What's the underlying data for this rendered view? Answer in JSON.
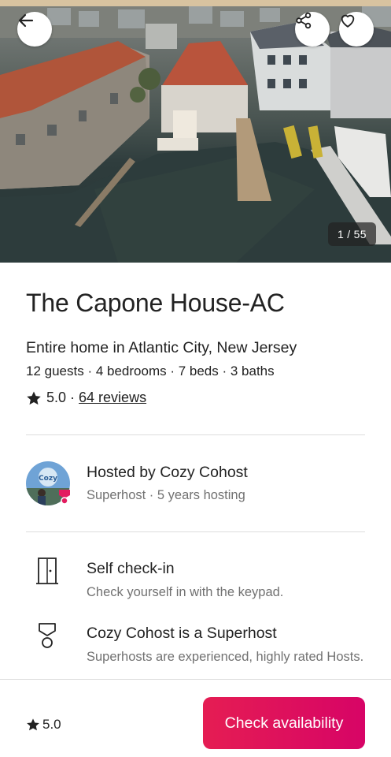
{
  "hero": {
    "photo_counter": "1 / 55"
  },
  "listing": {
    "title": "The Capone House-AC",
    "subtitle": "Entire home in Atlantic City, New Jersey",
    "specs": "12 guests · 4 bedrooms · 7 beds · 3 baths",
    "rating": "5.0",
    "rating_separator": " · ",
    "reviews_link": "64 reviews"
  },
  "host": {
    "name": "Hosted by Cozy Cohost",
    "meta": "Superhost · 5 years hosting"
  },
  "features": [
    {
      "icon": "door-icon",
      "title": "Self check-in",
      "description": "Check yourself in with the keypad."
    },
    {
      "icon": "medal-icon",
      "title": "Cozy Cohost is a Superhost",
      "description": "Superhosts are experienced, highly rated Hosts."
    }
  ],
  "footer": {
    "rating": "5.0",
    "cta_label": "Check availability"
  },
  "colors": {
    "brand": "#e51d53",
    "text": "#222222",
    "muted": "#717171",
    "divider": "#dddddd"
  }
}
